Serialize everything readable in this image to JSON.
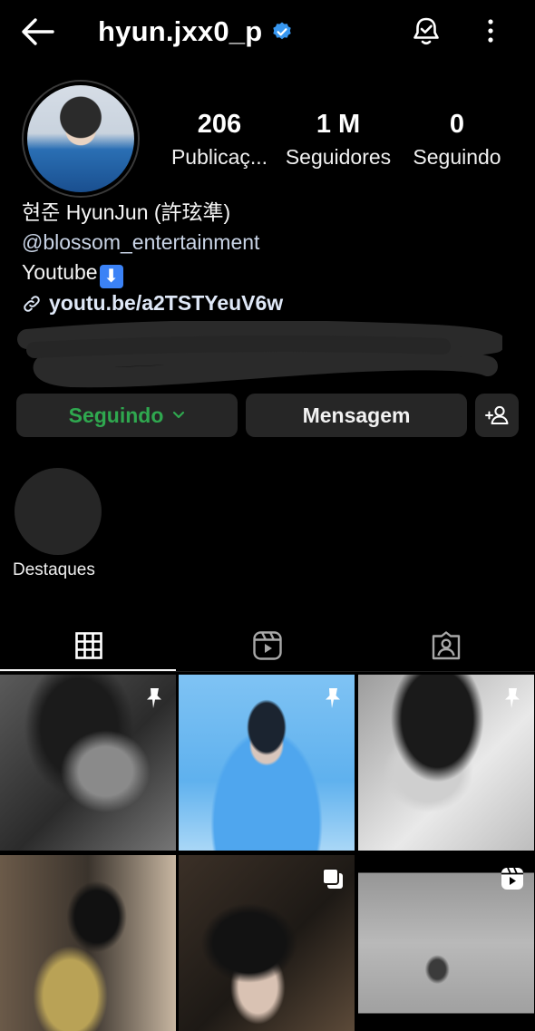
{
  "header": {
    "username": "hyun.jxx0_p",
    "back_icon": "arrow-left-icon",
    "verified_icon": "verified-badge-icon",
    "notifications_icon": "bell-check-icon",
    "more_icon": "more-vertical-icon"
  },
  "stats": [
    {
      "value": "206",
      "label": "Publicaç..."
    },
    {
      "value": "1 M",
      "label": "Seguidores"
    },
    {
      "value": "0",
      "label": "Seguindo"
    }
  ],
  "bio": {
    "name": "현준 HyunJun  (許玹準)",
    "mention": "@blossom_entertainment",
    "line": "Youtube",
    "emoji": "⬇",
    "link": "youtu.be/a2TSTYeuV6w"
  },
  "buttons": {
    "following_label": "Seguindo",
    "message_label": "Mensagem",
    "suggest_icon": "add-person-icon"
  },
  "highlights": {
    "label": "Destaques"
  },
  "tabs": [
    "grid-icon",
    "reels-icon",
    "tagged-icon"
  ],
  "colors": {
    "following_text": "#2fa84f",
    "verified": "#3897f0",
    "button_bg": "#262626"
  }
}
